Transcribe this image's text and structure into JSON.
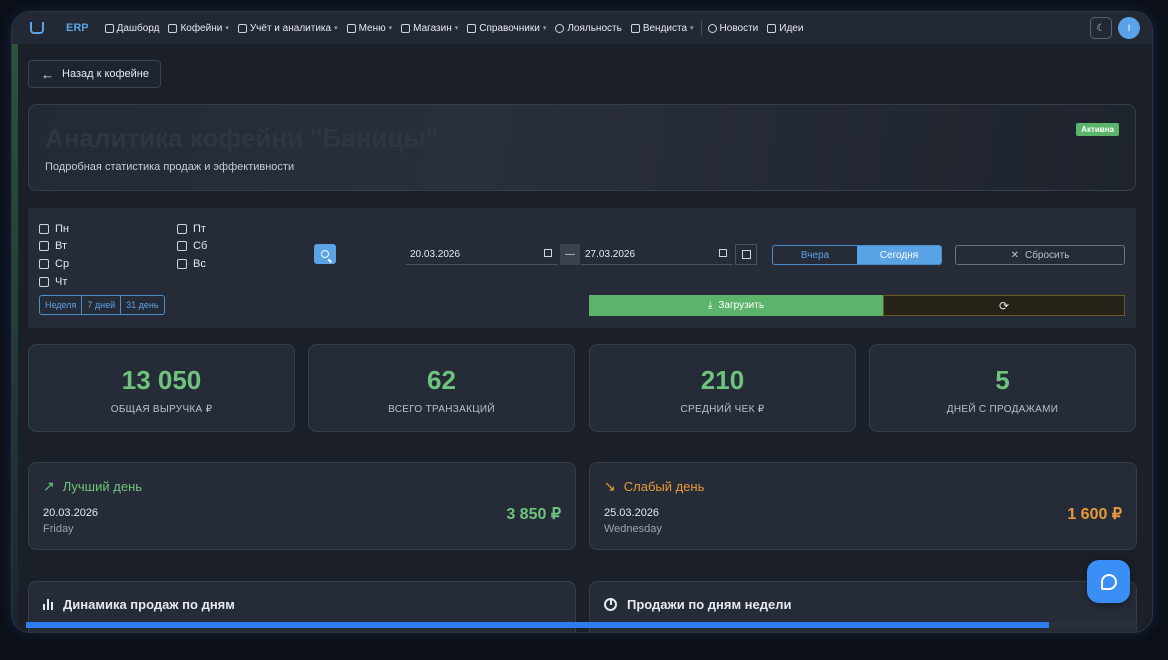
{
  "nav": {
    "logo": "ERP",
    "items": [
      {
        "label": "Дашборд",
        "caret": false
      },
      {
        "label": "Кофейни",
        "caret": true
      },
      {
        "label": "Учёт и аналитика",
        "caret": true
      },
      {
        "label": "Меню",
        "caret": true
      },
      {
        "label": "Магазин",
        "caret": true
      },
      {
        "label": "Справочники",
        "caret": true
      },
      {
        "label": "Лояльность",
        "caret": false
      },
      {
        "label": "Вендиста",
        "caret": true
      },
      {
        "label": "Новости",
        "caret": false
      },
      {
        "label": "Идеи",
        "caret": false
      }
    ],
    "avatar_letter": "I"
  },
  "back_label": "Назад к кофейне",
  "hero": {
    "title": "Аналитика кофейни \"Баницы\"",
    "subtitle": "Подробная статистика продаж и эффективности",
    "badge": "Активна"
  },
  "filters": {
    "days": [
      "Пн",
      "Вт",
      "Ср",
      "Чт",
      "Пт",
      "Сб",
      "Вс"
    ],
    "periods": [
      "Неделя",
      "7 дней",
      "31 день"
    ],
    "date_from": "20.03.2026",
    "date_to": "27.03.2026",
    "yesterday": "Вчера",
    "today": "Сегодня",
    "reset": "Сбросить",
    "load": "Загрузить"
  },
  "stats": [
    {
      "value": "13 050",
      "label": "ОБЩАЯ ВЫРУЧКА ₽"
    },
    {
      "value": "62",
      "label": "ВСЕГО ТРАНЗАКЦИЙ"
    },
    {
      "value": "210",
      "label": "СРЕДНИЙ ЧЕК ₽"
    },
    {
      "value": "5",
      "label": "ДНЕЙ С ПРОДАЖАМИ"
    }
  ],
  "best_day": {
    "title": "Лучший день",
    "date": "20.03.2026",
    "weekday": "Friday",
    "amount": "3 850 ₽",
    "color": "#6ec47c"
  },
  "worst_day": {
    "title": "Слабый день",
    "date": "25.03.2026",
    "weekday": "Wednesday",
    "amount": "1 600 ₽",
    "color": "#e69a3c"
  },
  "charts": {
    "daily": "Динамика продаж по дням",
    "weekday": "Продажи по дням недели"
  },
  "progress": 0.92
}
